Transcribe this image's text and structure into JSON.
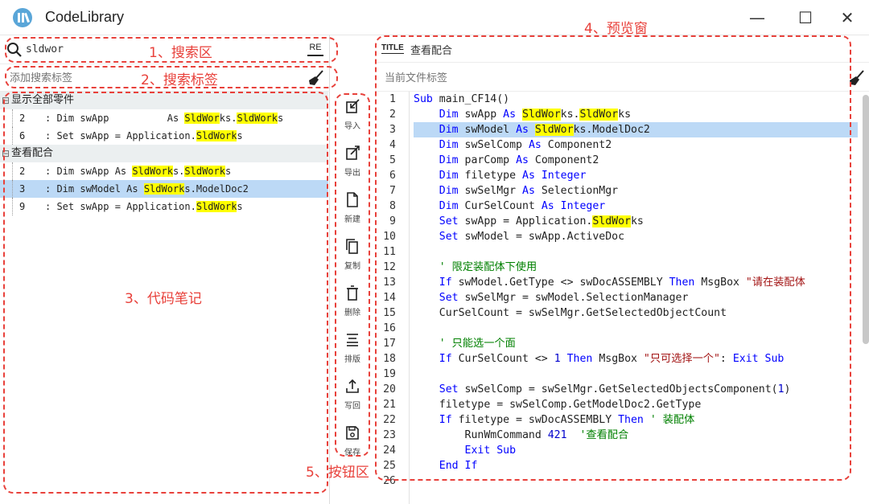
{
  "window": {
    "title": "CodeLibrary",
    "controls": {
      "minimize": "—",
      "maximize": "☐",
      "close": "✕"
    }
  },
  "search": {
    "value": "sldwor",
    "regex_label": "RE",
    "tag_placeholder": "添加搜索标签"
  },
  "tree": {
    "groups": [
      {
        "title": "显示全部零件",
        "items": [
          {
            "line": "2",
            "pre": ": Dim swApp          As ",
            "h1": "SldWor",
            "mid": "ks.",
            "h2": "SldWork",
            "post": "s"
          },
          {
            "line": "6",
            "pre": ": Set swApp = Application.",
            "h1": "SldWork",
            "mid": "s",
            "h2": "",
            "post": ""
          }
        ]
      },
      {
        "title": "查看配合",
        "items": [
          {
            "line": "2",
            "pre": ": Dim swApp As ",
            "h1": "SldWork",
            "mid": "s.",
            "h2": "SldWork",
            "post": "s"
          },
          {
            "line": "3",
            "pre": ": Dim swModel As ",
            "h1": "SldWork",
            "mid": "s.ModelDoc2",
            "h2": "",
            "post": ""
          },
          {
            "line": "9",
            "pre": ": Set swApp = Application.",
            "h1": "SldWork",
            "mid": "s",
            "h2": "",
            "post": ""
          }
        ]
      }
    ]
  },
  "toolbar": {
    "buttons": [
      {
        "label": "导入",
        "icon": "import-icon"
      },
      {
        "label": "导出",
        "icon": "export-icon"
      },
      {
        "label": "新建",
        "icon": "new-file-icon"
      },
      {
        "label": "复制",
        "icon": "copy-icon"
      },
      {
        "label": "删除",
        "icon": "delete-icon"
      },
      {
        "label": "排版",
        "icon": "format-icon"
      },
      {
        "label": "写回",
        "icon": "writeback-icon"
      },
      {
        "label": "保存",
        "icon": "save-icon"
      }
    ]
  },
  "preview": {
    "title_badge": "TITLE",
    "title": "查看配合",
    "file_tag_placeholder": "当前文件标签",
    "active_line": 3,
    "lines": [
      [
        [
          "kw",
          "Sub"
        ],
        [
          "p",
          " main_CF14()"
        ]
      ],
      [
        [
          "p",
          "    "
        ],
        [
          "kw",
          "Dim"
        ],
        [
          "p",
          " swApp "
        ],
        [
          "kw",
          "As"
        ],
        [
          "p",
          " "
        ],
        [
          "hl",
          "SldWor"
        ],
        [
          "p",
          "ks."
        ],
        [
          "hl",
          "SldWor"
        ],
        [
          "p",
          "ks"
        ]
      ],
      [
        [
          "p",
          "    "
        ],
        [
          "kw",
          "Dim"
        ],
        [
          "p",
          " swModel "
        ],
        [
          "kw",
          "As"
        ],
        [
          "p",
          " "
        ],
        [
          "hl",
          "SldWor"
        ],
        [
          "p",
          "ks.ModelDoc2"
        ]
      ],
      [
        [
          "p",
          "    "
        ],
        [
          "kw",
          "Dim"
        ],
        [
          "p",
          " swSelComp "
        ],
        [
          "kw",
          "As"
        ],
        [
          "p",
          " Component2"
        ]
      ],
      [
        [
          "p",
          "    "
        ],
        [
          "kw",
          "Dim"
        ],
        [
          "p",
          " parComp "
        ],
        [
          "kw",
          "As"
        ],
        [
          "p",
          " Component2"
        ]
      ],
      [
        [
          "p",
          "    "
        ],
        [
          "kw",
          "Dim"
        ],
        [
          "p",
          " filetype "
        ],
        [
          "kw",
          "As"
        ],
        [
          "p",
          " "
        ],
        [
          "kw",
          "Integer"
        ]
      ],
      [
        [
          "p",
          "    "
        ],
        [
          "kw",
          "Dim"
        ],
        [
          "p",
          " swSelMgr "
        ],
        [
          "kw",
          "As"
        ],
        [
          "p",
          " SelectionMgr"
        ]
      ],
      [
        [
          "p",
          "    "
        ],
        [
          "kw",
          "Dim"
        ],
        [
          "p",
          " CurSelCount "
        ],
        [
          "kw",
          "As"
        ],
        [
          "p",
          " "
        ],
        [
          "kw",
          "Integer"
        ]
      ],
      [
        [
          "p",
          "    "
        ],
        [
          "kw",
          "Set"
        ],
        [
          "p",
          " swApp = Application."
        ],
        [
          "hl",
          "SldWor"
        ],
        [
          "p",
          "ks"
        ]
      ],
      [
        [
          "p",
          "    "
        ],
        [
          "kw",
          "Set"
        ],
        [
          "p",
          " swModel = swApp.ActiveDoc"
        ]
      ],
      [
        [
          "p",
          ""
        ]
      ],
      [
        [
          "p",
          "    "
        ],
        [
          "cm",
          "' 限定装配体下使用"
        ]
      ],
      [
        [
          "p",
          "    "
        ],
        [
          "kw",
          "If"
        ],
        [
          "p",
          " swModel.GetType <> swDocASSEMBLY "
        ],
        [
          "kw",
          "Then"
        ],
        [
          "p",
          " MsgBox "
        ],
        [
          "str",
          "\"请在装配体"
        ]
      ],
      [
        [
          "p",
          "    "
        ],
        [
          "kw",
          "Set"
        ],
        [
          "p",
          " swSelMgr = swModel.SelectionManager"
        ]
      ],
      [
        [
          "p",
          "    CurSelCount = swSelMgr.GetSelectedObjectCount"
        ]
      ],
      [
        [
          "p",
          ""
        ]
      ],
      [
        [
          "p",
          "    "
        ],
        [
          "cm",
          "' 只能选一个面"
        ]
      ],
      [
        [
          "p",
          "    "
        ],
        [
          "kw",
          "If"
        ],
        [
          "p",
          " CurSelCount <> "
        ],
        [
          "num",
          "1"
        ],
        [
          "p",
          " "
        ],
        [
          "kw",
          "Then"
        ],
        [
          "p",
          " MsgBox "
        ],
        [
          "str",
          "\"只可选择一个\""
        ],
        [
          "p",
          ": "
        ],
        [
          "kw",
          "Exit Sub"
        ]
      ],
      [
        [
          "p",
          ""
        ]
      ],
      [
        [
          "p",
          "    "
        ],
        [
          "kw",
          "Set"
        ],
        [
          "p",
          " swSelComp = swSelMgr.GetSelectedObjectsComponent("
        ],
        [
          "num",
          "1"
        ],
        [
          "p",
          ")"
        ]
      ],
      [
        [
          "p",
          "    filetype = swSelComp.GetModelDoc2.GetType"
        ]
      ],
      [
        [
          "p",
          "    "
        ],
        [
          "kw",
          "If"
        ],
        [
          "p",
          " filetype = swDocASSEMBLY "
        ],
        [
          "kw",
          "Then"
        ],
        [
          "p",
          " "
        ],
        [
          "cm",
          "' 装配体"
        ]
      ],
      [
        [
          "p",
          "        RunWmCommand "
        ],
        [
          "num",
          "421"
        ],
        [
          "p",
          "  "
        ],
        [
          "cm",
          "'查看配合"
        ]
      ],
      [
        [
          "p",
          "        "
        ],
        [
          "kw",
          "Exit Sub"
        ]
      ],
      [
        [
          "p",
          "    "
        ],
        [
          "kw",
          "End If"
        ]
      ],
      [
        [
          "p",
          ""
        ]
      ]
    ]
  },
  "annotations": {
    "search_area": "1、搜索区",
    "search_tags": "2、搜索标签",
    "code_notes": "3、代码笔记",
    "preview_window": "4、预览窗",
    "button_area": "5、按钮区"
  }
}
